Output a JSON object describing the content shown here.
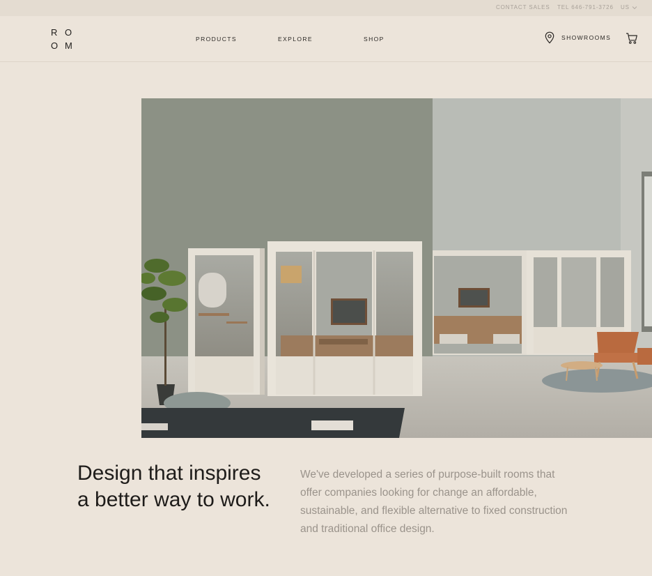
{
  "utility": {
    "contact_sales": "CONTACT SALES",
    "tel": "TEL 646-791-3726",
    "region": "US"
  },
  "logo": {
    "letters": [
      "R",
      "O",
      "O",
      "M"
    ]
  },
  "nav": {
    "products": "PRODUCTS",
    "explore": "EXPLORE",
    "shop": "SHOP",
    "showrooms": "SHOWROOMS"
  },
  "icons": {
    "location": "map-pin-icon",
    "cart": "cart-icon",
    "region_chevron": "chevron-down-icon"
  },
  "hero": {
    "image": "office-phone-booths-photo"
  },
  "intro": {
    "headline": "Design that inspires a better way to work.",
    "description": "We've developed a series of purpose-built rooms that offer companies looking for change an affordable, sustainable, and flexible alternative to fixed construction and traditional office design."
  },
  "colors": {
    "background": "#ece4da",
    "text": "#1e1c1a",
    "muted": "#9a938b"
  }
}
